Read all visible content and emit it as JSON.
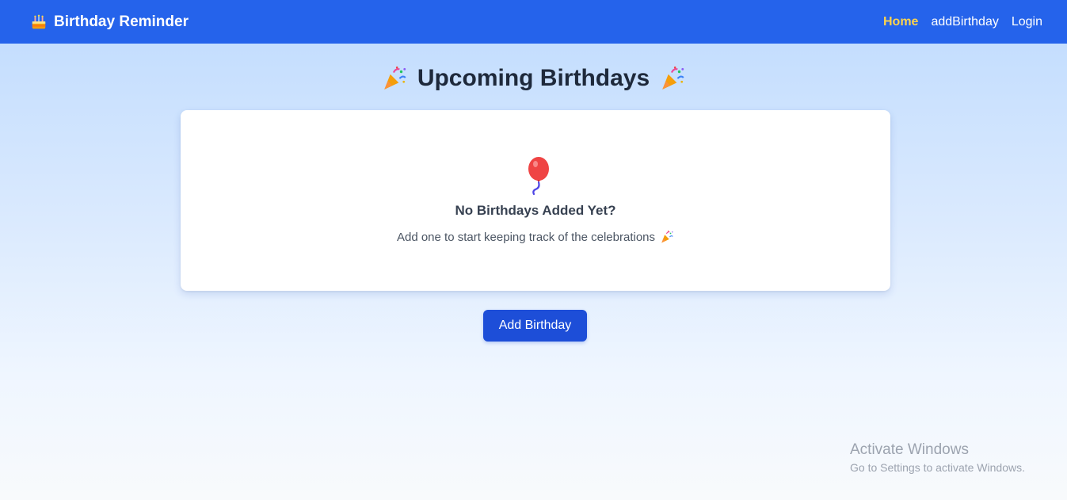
{
  "navbar": {
    "brand": "Birthday Reminder",
    "brand_icon": "cake-icon",
    "links": [
      {
        "label": "Home",
        "active": true
      },
      {
        "label": "addBirthday",
        "active": false
      },
      {
        "label": "Login",
        "active": false
      }
    ],
    "background_color": "#2563eb",
    "active_color": "#fcd34d"
  },
  "main": {
    "title": "Upcoming Birthdays",
    "title_icon": "party-popper-icon",
    "empty_state": {
      "icon": "balloon-icon",
      "title": "No Birthdays Added Yet?",
      "subtitle": "Add one to start keeping track of the celebrations"
    },
    "add_button_label": "Add Birthday",
    "button_color": "#1d4ed8"
  },
  "watermark": {
    "title": "Activate Windows",
    "subtitle": "Go to Settings to activate Windows."
  }
}
